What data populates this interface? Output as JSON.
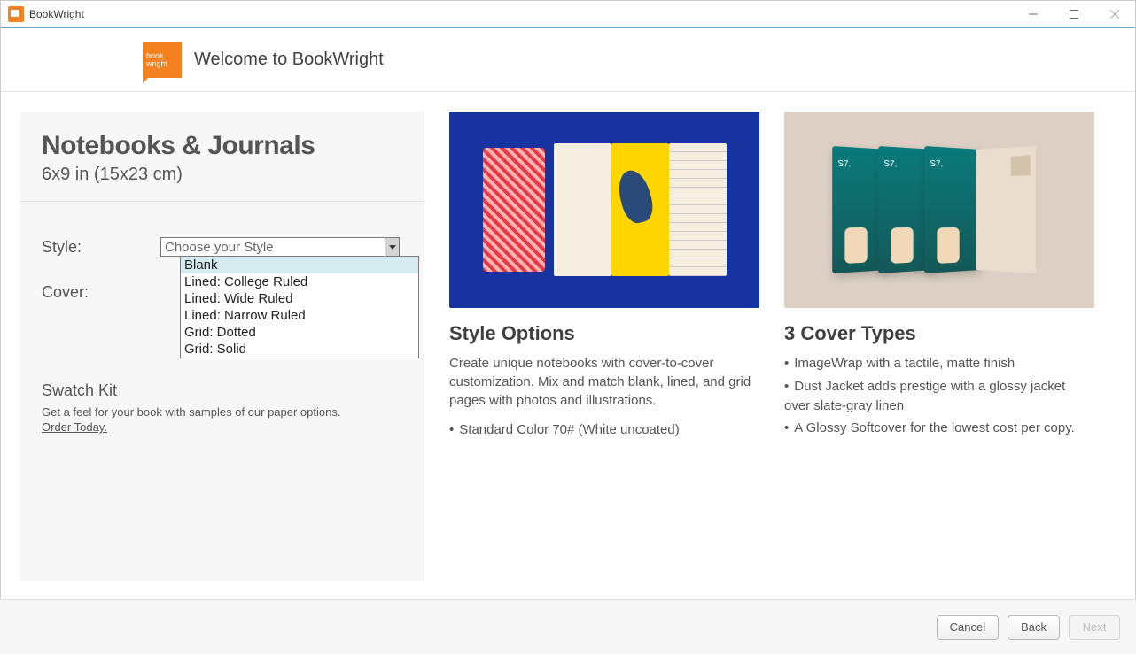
{
  "window": {
    "title": "BookWright"
  },
  "header": {
    "logo_text_1": "book",
    "logo_text_2": "wright",
    "welcome": "Welcome to BookWright"
  },
  "left": {
    "title": "Notebooks & Journals",
    "subtitle": "6x9 in (15x23 cm)",
    "style_label": "Style:",
    "cover_label": "Cover:",
    "style_placeholder": "Choose your Style",
    "options": {
      "o0": "Blank",
      "o1": "Lined: College Ruled",
      "o2": "Lined: Wide Ruled",
      "o3": "Lined: Narrow Ruled",
      "o4": "Grid: Dotted",
      "o5": "Grid: Solid"
    },
    "swatch_title": "Swatch Kit",
    "swatch_desc": "Get a feel for your book with samples of our paper options.",
    "swatch_link": "Order Today."
  },
  "mid": {
    "title": "Style Options",
    "desc": "Create unique notebooks with cover-to-cover customization. Mix and match blank, lined, and grid pages with photos and illustrations.",
    "bullet1": "Standard Color 70# (White uncoated)"
  },
  "right": {
    "title": "3 Cover Types",
    "bullet1": "ImageWrap with a tactile, matte finish",
    "bullet2": "Dust Jacket adds prestige with a glossy jacket over slate-gray linen",
    "bullet3": "A Glossy Softcover for the lowest cost per copy.",
    "book_label": "S7."
  },
  "footer": {
    "cancel": "Cancel",
    "back": "Back",
    "next": "Next"
  }
}
